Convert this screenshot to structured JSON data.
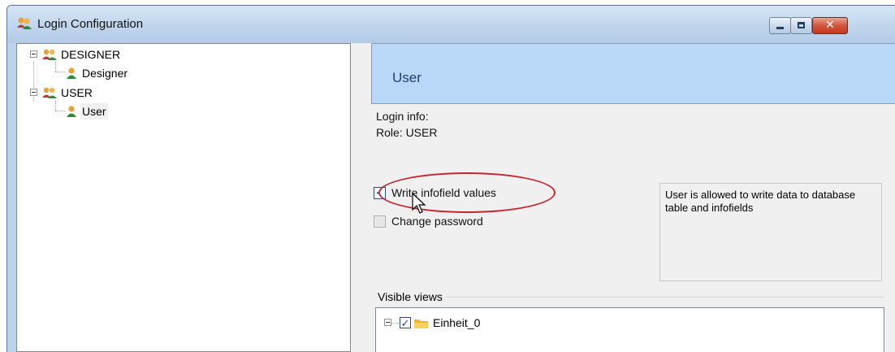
{
  "window": {
    "title": "Login Configuration",
    "accent_color": "#c1272d",
    "header_color": "#b9d8f8"
  },
  "tree": {
    "groups": [
      {
        "label": "DESIGNER",
        "icon": "users-group-icon",
        "children": [
          {
            "label": "Designer",
            "icon": "user-icon"
          }
        ]
      },
      {
        "label": "USER",
        "icon": "users-group-icon",
        "children": [
          {
            "label": "User",
            "icon": "user-icon",
            "selected": true
          }
        ]
      }
    ]
  },
  "detail": {
    "header_title": "User",
    "login_info_label": "Login info:",
    "role_text": "Role: USER",
    "permissions": [
      {
        "label": "Write infofield values",
        "checked": true
      },
      {
        "label": "Change password",
        "checked": false
      }
    ],
    "description": "User is allowed to write data to database table and infofields",
    "visible_views_label": "Visible views",
    "views": [
      {
        "label": "Einheit_0",
        "checked": true,
        "icon": "folder-icon"
      }
    ]
  }
}
